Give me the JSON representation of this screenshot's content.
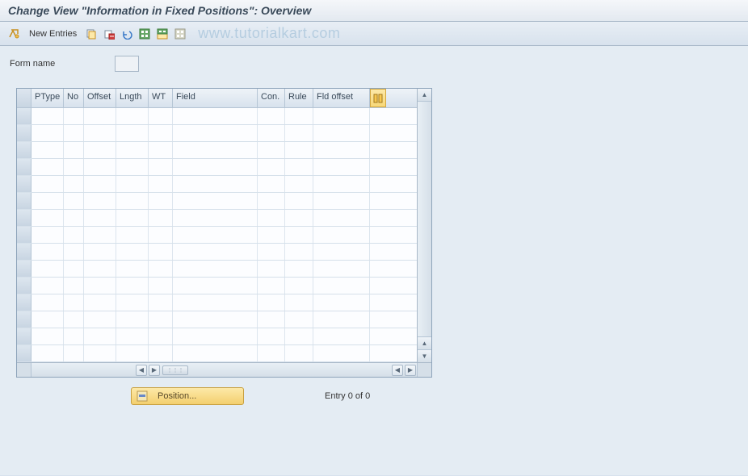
{
  "title": "Change View \"Information in Fixed Positions\": Overview",
  "toolbar": {
    "new_entries_label": "New Entries"
  },
  "watermark": "www.tutorialkart.com",
  "form": {
    "name_label": "Form name",
    "name_value": ""
  },
  "table": {
    "columns": {
      "ptype": "PType",
      "no": "No",
      "offset": "Offset",
      "length": "Lngth",
      "wt": "WT",
      "field": "Field",
      "con": "Con.",
      "rule": "Rule",
      "fld_offset": "Fld offset"
    }
  },
  "buttons": {
    "position_label": "Position..."
  },
  "status": {
    "entry_text": "Entry 0 of 0"
  }
}
